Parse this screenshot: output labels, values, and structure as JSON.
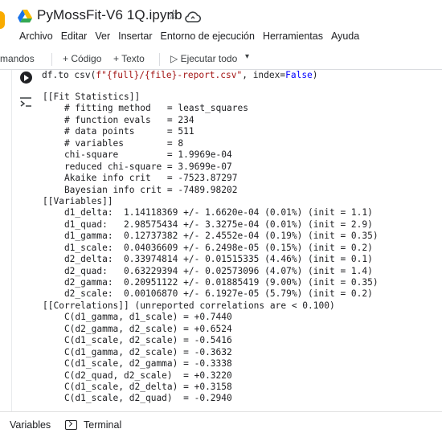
{
  "app": {
    "title": "PyMossFit-V6 1Q.ipynb",
    "icons": [
      "drive-logo-icon",
      "star-icon",
      "cloud-icon"
    ]
  },
  "menu": [
    "Archivo",
    "Editar",
    "Ver",
    "Insertar",
    "Entorno de ejecución",
    "Herramientas",
    "Ayuda"
  ],
  "toolbar": {
    "commands_label": "mandos",
    "add_code_label": "+ Código",
    "add_text_label": "+ Texto",
    "run_all_label": "▷ Ejecutar todo",
    "run_all_caret": "▾"
  },
  "cell": {
    "code_prefix": "df.to_csv(",
    "code_string": "f\"{full}/{file}-report.csv\"",
    "code_suffix": ", index=",
    "code_keyword": "False",
    "code_end": ")"
  },
  "output_lines": [
    "[[Fit Statistics]]",
    "    # fitting method   = least_squares",
    "    # function evals   = 234",
    "    # data points      = 511",
    "    # variables        = 8",
    "    chi-square         = 1.9969e-04",
    "    reduced chi-square = 3.9699e-07",
    "    Akaike info crit   = -7523.87297",
    "    Bayesian info crit = -7489.98202",
    "[[Variables]]",
    "    d1_delta:  1.14118369 +/- 1.6620e-04 (0.01%) (init = 1.1)",
    "    d1_quad:   2.98575434 +/- 3.3275e-04 (0.01%) (init = 2.9)",
    "    d1_gamma:  0.12737382 +/- 2.4552e-04 (0.19%) (init = 0.35)",
    "    d1_scale:  0.04036609 +/- 6.2498e-05 (0.15%) (init = 0.2)",
    "    d2_delta:  0.33974814 +/- 0.01515335 (4.46%) (init = 0.1)",
    "    d2_quad:   0.63229394 +/- 0.02573096 (4.07%) (init = 1.4)",
    "    d2_gamma:  0.20951122 +/- 0.01885419 (9.00%) (init = 0.35)",
    "    d2_scale:  0.00106870 +/- 6.1927e-05 (5.79%) (init = 0.2)",
    "[[Correlations]] (unreported correlations are < 0.100)",
    "    C(d1_gamma, d1_scale) = +0.7440",
    "    C(d2_gamma, d2_scale) = +0.6524",
    "    C(d1_scale, d2_scale) = -0.5416",
    "    C(d1_gamma, d2_scale) = -0.3632",
    "    C(d1_scale, d2_gamma) = -0.3338",
    "    C(d2_quad, d2_scale)  = +0.3220",
    "    C(d1_scale, d2_delta) = +0.3158",
    "    C(d1_scale, d2_quad)  = -0.2940"
  ],
  "bottom": {
    "variables_label": "Variables",
    "terminal_label": "Terminal"
  },
  "colors": {
    "accent": "#f9ab00",
    "string": "#a31515",
    "keyword": "#0000ff"
  }
}
